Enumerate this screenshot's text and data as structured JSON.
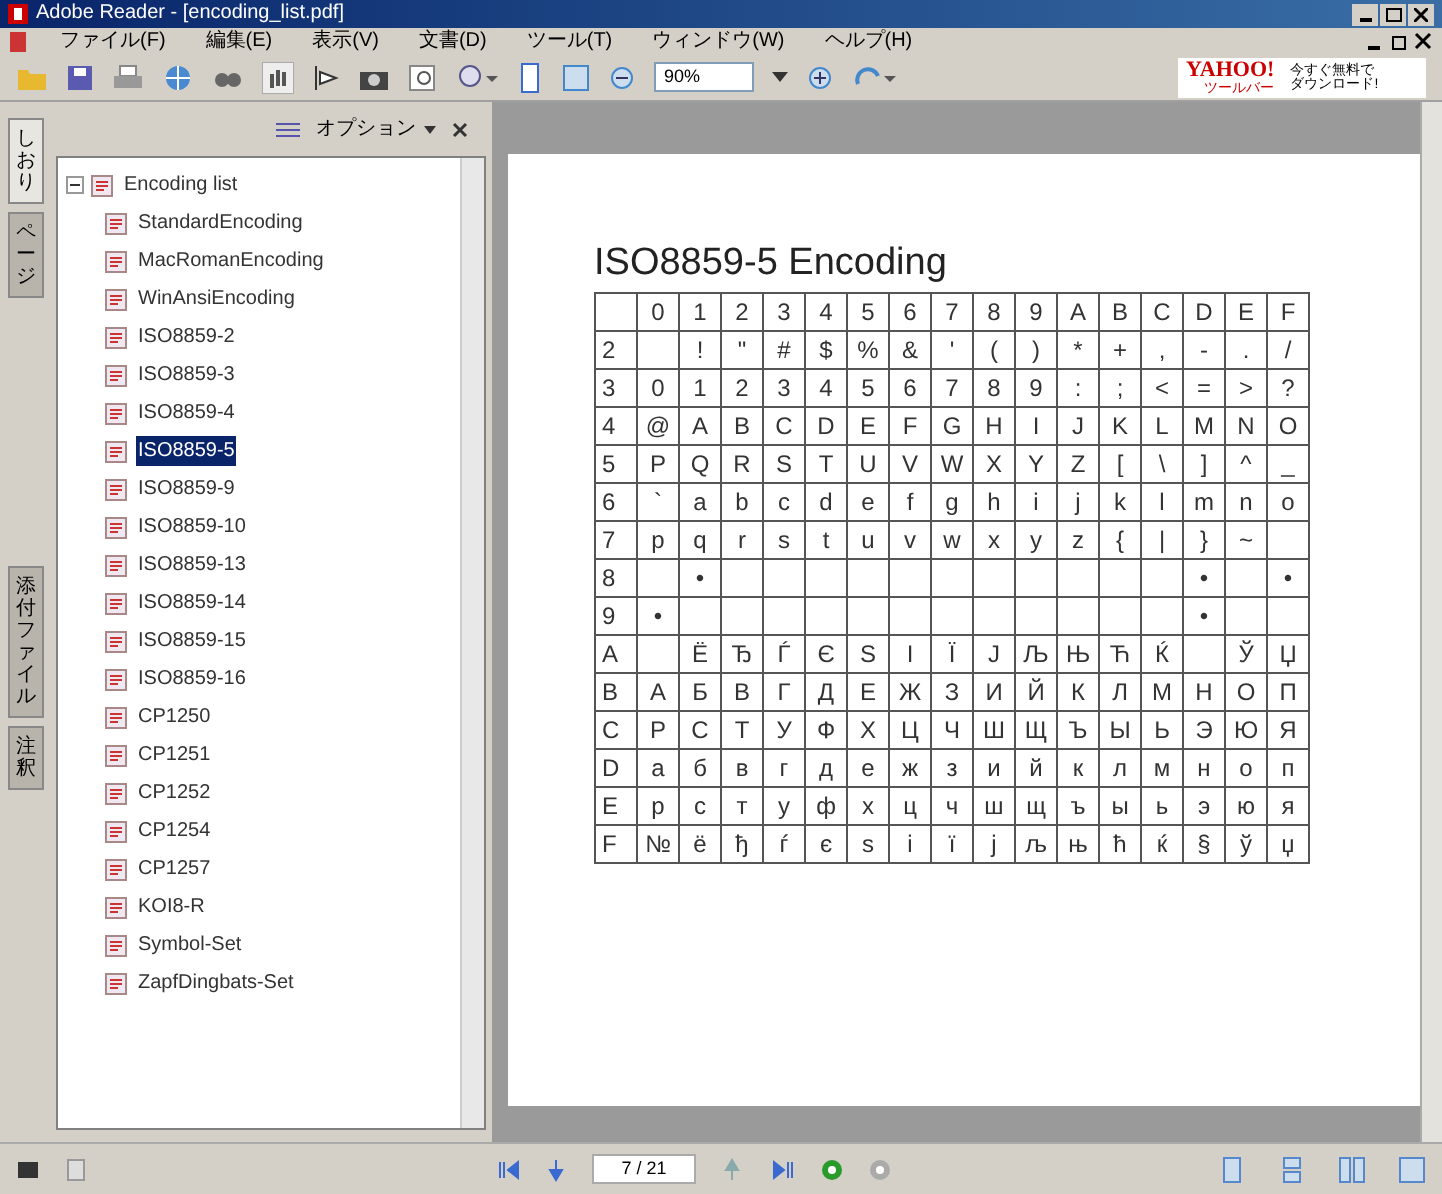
{
  "window": {
    "title": "Adobe Reader - [encoding_list.pdf]"
  },
  "menu": [
    "ファイル(F)",
    "編集(E)",
    "表示(V)",
    "文書(D)",
    "ツール(T)",
    "ウィンドウ(W)",
    "ヘルプ(H)"
  ],
  "toolbar": {
    "zoom": "90%"
  },
  "ad": {
    "brand": "YAHOO!",
    "line_1": "ツールバー",
    "line_2": "今すぐ無料で",
    "line_3": "ダウンロード!"
  },
  "side_tabs": [
    {
      "label": "しおり",
      "selected": true
    },
    {
      "label": "ページ",
      "selected": false
    },
    {
      "label": "添付ファイル",
      "selected": false
    },
    {
      "label": "注釈",
      "selected": false
    }
  ],
  "bookmarks": {
    "options": "オプション",
    "tree": [
      {
        "label": "Encoding list",
        "expanded": true,
        "selected": false,
        "children": [
          {
            "label": "StandardEncoding",
            "selected": false
          },
          {
            "label": "MacRomanEncoding",
            "selected": false
          },
          {
            "label": "WinAnsiEncoding",
            "selected": false
          },
          {
            "label": "ISO8859-2",
            "selected": false
          },
          {
            "label": "ISO8859-3",
            "selected": false
          },
          {
            "label": "ISO8859-4",
            "selected": false
          },
          {
            "label": "ISO8859-5",
            "selected": true
          },
          {
            "label": "ISO8859-9",
            "selected": false
          },
          {
            "label": "ISO8859-10",
            "selected": false
          },
          {
            "label": "ISO8859-13",
            "selected": false
          },
          {
            "label": "ISO8859-14",
            "selected": false
          },
          {
            "label": "ISO8859-15",
            "selected": false
          },
          {
            "label": "ISO8859-16",
            "selected": false
          },
          {
            "label": "CP1250",
            "selected": false
          },
          {
            "label": "CP1251",
            "selected": false
          },
          {
            "label": "CP1252",
            "selected": false
          },
          {
            "label": "CP1254",
            "selected": false
          },
          {
            "label": "CP1257",
            "selected": false
          },
          {
            "label": "KOI8-R",
            "selected": false
          },
          {
            "label": "Symbol-Set",
            "selected": false
          },
          {
            "label": "ZapfDingbats-Set",
            "selected": false
          }
        ]
      }
    ]
  },
  "document": {
    "heading": "ISO8859-5 Encoding",
    "table": {
      "columns": [
        "0",
        "1",
        "2",
        "3",
        "4",
        "5",
        "6",
        "7",
        "8",
        "9",
        "A",
        "B",
        "C",
        "D",
        "E",
        "F"
      ],
      "rows": [
        {
          "header": "2",
          "cells": [
            null,
            "!",
            "\"",
            "#",
            "$",
            "%",
            "&",
            "'",
            "(",
            ")",
            "*",
            "+",
            ",",
            "-",
            ".",
            "/"
          ]
        },
        {
          "header": "3",
          "cells": [
            "0",
            "1",
            "2",
            "3",
            "4",
            "5",
            "6",
            "7",
            "8",
            "9",
            ":",
            ";",
            "<",
            "=",
            ">",
            "?"
          ]
        },
        {
          "header": "4",
          "cells": [
            "@",
            "A",
            "B",
            "C",
            "D",
            "E",
            "F",
            "G",
            "H",
            "I",
            "J",
            "K",
            "L",
            "M",
            "N",
            "O"
          ]
        },
        {
          "header": "5",
          "cells": [
            "P",
            "Q",
            "R",
            "S",
            "T",
            "U",
            "V",
            "W",
            "X",
            "Y",
            "Z",
            "[",
            "\\",
            "]",
            "^",
            "_"
          ]
        },
        {
          "header": "6",
          "cells": [
            "`",
            "a",
            "b",
            "c",
            "d",
            "e",
            "f",
            "g",
            "h",
            "i",
            "j",
            "k",
            "l",
            "m",
            "n",
            "o"
          ]
        },
        {
          "header": "7",
          "cells": [
            "p",
            "q",
            "r",
            "s",
            "t",
            "u",
            "v",
            "w",
            "x",
            "y",
            "z",
            "{",
            "|",
            "}",
            "~",
            null
          ]
        },
        {
          "header": "8",
          "cells": [
            null,
            "•",
            null,
            null,
            null,
            null,
            null,
            null,
            null,
            null,
            null,
            null,
            null,
            "•",
            null,
            "•"
          ]
        },
        {
          "header": "9",
          "cells": [
            "•",
            null,
            null,
            null,
            null,
            null,
            null,
            null,
            null,
            null,
            null,
            null,
            null,
            "•",
            null,
            null
          ]
        },
        {
          "header": "A",
          "cells": [
            null,
            "Ё",
            "Ђ",
            "Ѓ",
            "Є",
            "Ѕ",
            "І",
            "Ї",
            "Ј",
            "Љ",
            "Њ",
            "Ћ",
            "Ќ",
            null,
            "Ў",
            "Џ"
          ]
        },
        {
          "header": "B",
          "cells": [
            "А",
            "Б",
            "В",
            "Г",
            "Д",
            "Е",
            "Ж",
            "З",
            "И",
            "Й",
            "К",
            "Л",
            "М",
            "Н",
            "О",
            "П"
          ]
        },
        {
          "header": "C",
          "cells": [
            "Р",
            "С",
            "Т",
            "У",
            "Ф",
            "Х",
            "Ц",
            "Ч",
            "Ш",
            "Щ",
            "Ъ",
            "Ы",
            "Ь",
            "Э",
            "Ю",
            "Я"
          ]
        },
        {
          "header": "D",
          "cells": [
            "а",
            "б",
            "в",
            "г",
            "д",
            "е",
            "ж",
            "з",
            "и",
            "й",
            "к",
            "л",
            "м",
            "н",
            "о",
            "п"
          ]
        },
        {
          "header": "E",
          "cells": [
            "р",
            "с",
            "т",
            "у",
            "ф",
            "х",
            "ц",
            "ч",
            "ш",
            "щ",
            "ъ",
            "ы",
            "ь",
            "э",
            "ю",
            "я"
          ]
        },
        {
          "header": "F",
          "cells": [
            "№",
            "ё",
            "ђ",
            "ѓ",
            "є",
            "ѕ",
            "і",
            "ї",
            "ј",
            "љ",
            "њ",
            "ћ",
            "ќ",
            "§",
            "ў",
            "џ"
          ]
        }
      ]
    }
  },
  "status_bar": {
    "page": "7 / 21"
  }
}
